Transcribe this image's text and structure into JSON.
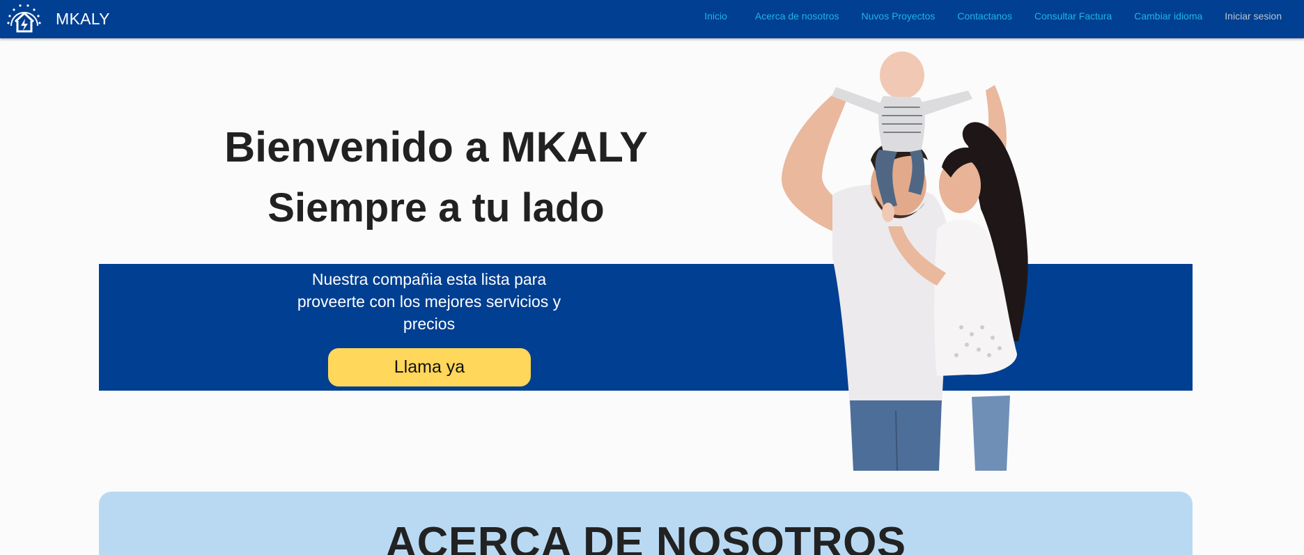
{
  "brand": {
    "name": "MKALY",
    "logo_icon": "house-sun-bolt-icon"
  },
  "nav": {
    "items": [
      {
        "label": "Inicio"
      },
      {
        "label": "Acerca de nosotros"
      },
      {
        "label": "Nuvos Proyectos"
      },
      {
        "label": "Contactanos"
      },
      {
        "label": "Consultar Factura"
      },
      {
        "label": "Cambiar idioma"
      },
      {
        "label": "Iniciar sesion"
      }
    ]
  },
  "hero": {
    "title": "Bienvenido a MKALY",
    "subtitle": "Siempre a tu lado",
    "text": "Nuestra compañia esta lista para proveerte con los mejores servicios y precios",
    "cta_label": "Llama ya"
  },
  "about": {
    "title": "ACERCA DE NOSOTROS"
  },
  "colors": {
    "primary": "#003f91",
    "nav_link": "#1fb6e6",
    "cta": "#ffd75a",
    "about_bg": "#b9d9f3",
    "page_bg": "#fbfbfc"
  }
}
